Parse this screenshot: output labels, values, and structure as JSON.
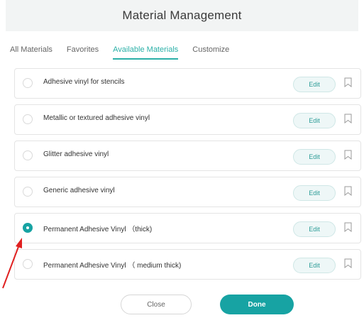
{
  "dialog": {
    "title": "Material Management"
  },
  "tabs": [
    {
      "label": "All Materials",
      "active": false
    },
    {
      "label": "Favorites",
      "active": false
    },
    {
      "label": "Available Materials",
      "active": true
    },
    {
      "label": "Customize",
      "active": false
    }
  ],
  "materials": [
    {
      "label": "Adhesive vinyl for stencils",
      "edit_label": "Edit",
      "selected": false
    },
    {
      "label": "Metallic or textured adhesive vinyl",
      "edit_label": "Edit",
      "selected": false
    },
    {
      "label": "Glitter adhesive vinyl",
      "edit_label": "Edit",
      "selected": false
    },
    {
      "label": "Generic adhesive vinyl",
      "edit_label": "Edit",
      "selected": false
    },
    {
      "label": "Permanent Adhesive Vinyl （thick)",
      "edit_label": "Edit",
      "selected": true
    },
    {
      "label": "Permanent Adhesive Vinyl （ medium thick)",
      "edit_label": "Edit",
      "selected": false
    }
  ],
  "footer": {
    "close_label": "Close",
    "done_label": "Done"
  },
  "colors": {
    "accent": "#17a3a3",
    "tab_active": "#2bb0a8",
    "annotation_arrow": "#e02020"
  },
  "icons": {
    "bookmark": "bookmark-icon",
    "radio": "radio-button",
    "arrow": "annotation-arrow"
  }
}
